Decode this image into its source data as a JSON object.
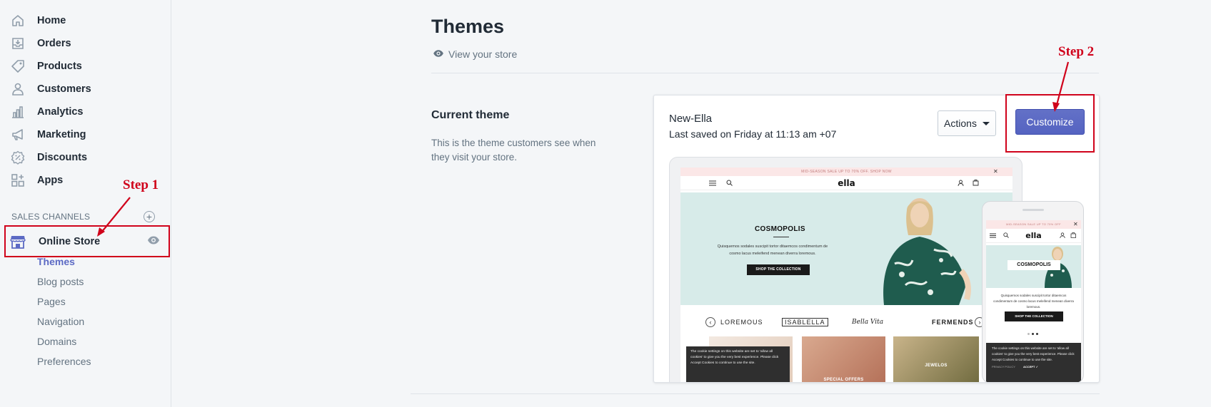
{
  "sidebar": {
    "items": [
      {
        "label": "Home",
        "icon": "home-icon"
      },
      {
        "label": "Orders",
        "icon": "orders-icon"
      },
      {
        "label": "Products",
        "icon": "tag-icon"
      },
      {
        "label": "Customers",
        "icon": "person-icon"
      },
      {
        "label": "Analytics",
        "icon": "bar-chart-icon"
      },
      {
        "label": "Marketing",
        "icon": "megaphone-icon"
      },
      {
        "label": "Discounts",
        "icon": "discount-icon"
      },
      {
        "label": "Apps",
        "icon": "apps-icon"
      }
    ],
    "sales_channels_heading": "SALES CHANNELS",
    "online_store": {
      "label": "Online Store",
      "icon": "store-icon"
    },
    "sub_items": [
      "Themes",
      "Blog posts",
      "Pages",
      "Navigation",
      "Domains",
      "Preferences"
    ],
    "active_sub_item": "Themes"
  },
  "annotations": {
    "step1": "Step 1",
    "step2": "Step 2",
    "color": "#d0021b"
  },
  "main": {
    "title": "Themes",
    "view_store": "View your store",
    "current_theme": {
      "heading": "Current theme",
      "description": "This is the theme customers see when they visit your store."
    },
    "theme_card": {
      "name": "New-Ella",
      "saved": "Last saved on Friday at 11:13 am +07",
      "actions_label": "Actions",
      "customize_label": "Customize"
    }
  },
  "preview": {
    "promo": "MID-SEASON SALE UP TO 70% OFF. SHOP NOW",
    "promo_close": "✕",
    "logo": "ella",
    "hero_title": "COSMOPOLIS",
    "hero_text": "Quisquemos sodales suscipit tortor ditaemcos condimentum de cosmo lacus meleifend menean diverra loremous.",
    "hero_button": "SHOP THE COLLECTION",
    "brands": [
      "LOREMOUS",
      "ISABLELLA",
      "Bella Vita",
      "FERMENDS"
    ],
    "tiles": [
      "SPECIAL OFFERS",
      "JEWELOS"
    ],
    "cookie_text": "The cookie settings on this website are set to 'allow all cookies' to give you the very best experience. Please click Accept Cookies to continue to use the site.",
    "cookie_accept": "ACCEPT ✓",
    "cookie_policy": "PRIVACY POLICY",
    "mobile_promo": "MID-SEASON SALE UP TO 70% OFF",
    "mobile_hero_text": "Quisquemos sodales suscipit tortor ditaemcos condimentum de cosmo lacus meleifend menean diverra loremous."
  },
  "colors": {
    "accent": "#5c6ac4",
    "annotation_red": "#d0021b",
    "hero_bg": "#d7ebe9",
    "promo_bg": "#fbe7e7"
  }
}
